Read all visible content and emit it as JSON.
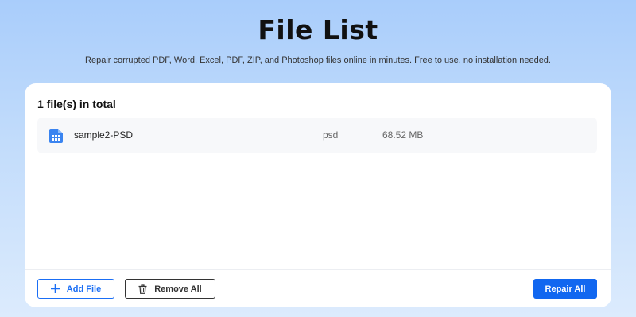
{
  "header": {
    "title": "File List",
    "subtitle": "Repair corrupted PDF, Word, Excel, PDF, ZIP, and Photoshop files online in minutes. Free to use, no installation needed."
  },
  "file_list": {
    "total_label": "1 file(s) in total",
    "files": [
      {
        "name": "sample2-PSD",
        "type": "psd",
        "size": "68.52 MB",
        "icon": "psd-file-icon"
      }
    ]
  },
  "actions": {
    "add_file_label": "Add File",
    "remove_all_label": "Remove All",
    "repair_all_label": "Repair All"
  },
  "colors": {
    "accent": "#1167f0",
    "file_icon": "#3a84f0",
    "background_top": "#a9cdfb",
    "background_bottom": "#dcebfd"
  }
}
